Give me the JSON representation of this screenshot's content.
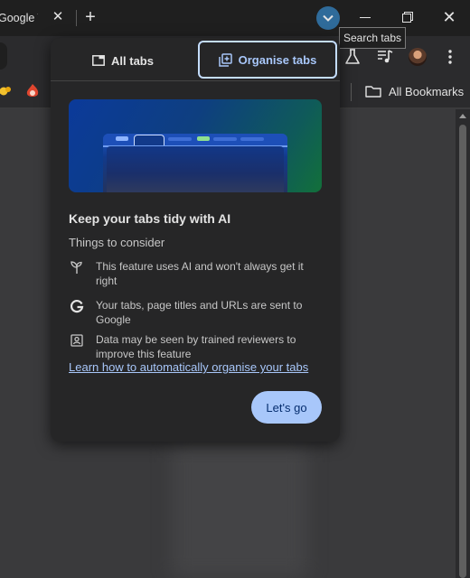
{
  "browser": {
    "tab_title": "Google Tasks",
    "close_tab_glyph": "✕",
    "new_tab_glyph": "+",
    "search_tabs_tooltip": "Search tabs",
    "close_window_glyph": "✕",
    "accent_color": "#2f6b9a"
  },
  "bookmarks_bar": {
    "all_bookmarks_label": "All Bookmarks"
  },
  "popup": {
    "tabs": [
      {
        "label": "All tabs",
        "icon": "tab-icon",
        "selected": false
      },
      {
        "label": "Organise tabs",
        "icon": "tab-organise-icon",
        "selected": true
      }
    ],
    "heading": "Keep your tabs tidy with AI",
    "subheading": "Things to consider",
    "items": [
      {
        "icon": "sprout-icon",
        "text": "This feature uses AI and won't always get it right"
      },
      {
        "icon": "google-g-icon",
        "text": "Your tabs, page titles and URLs are sent to Google"
      },
      {
        "icon": "reviewer-badge-icon",
        "text": "Data may be seen by trained reviewers to improve this feature"
      }
    ],
    "learn_more_link": "Learn how to automatically organise your tabs",
    "primary_button": "Let's go",
    "primary_color": "#a8c7fa"
  }
}
